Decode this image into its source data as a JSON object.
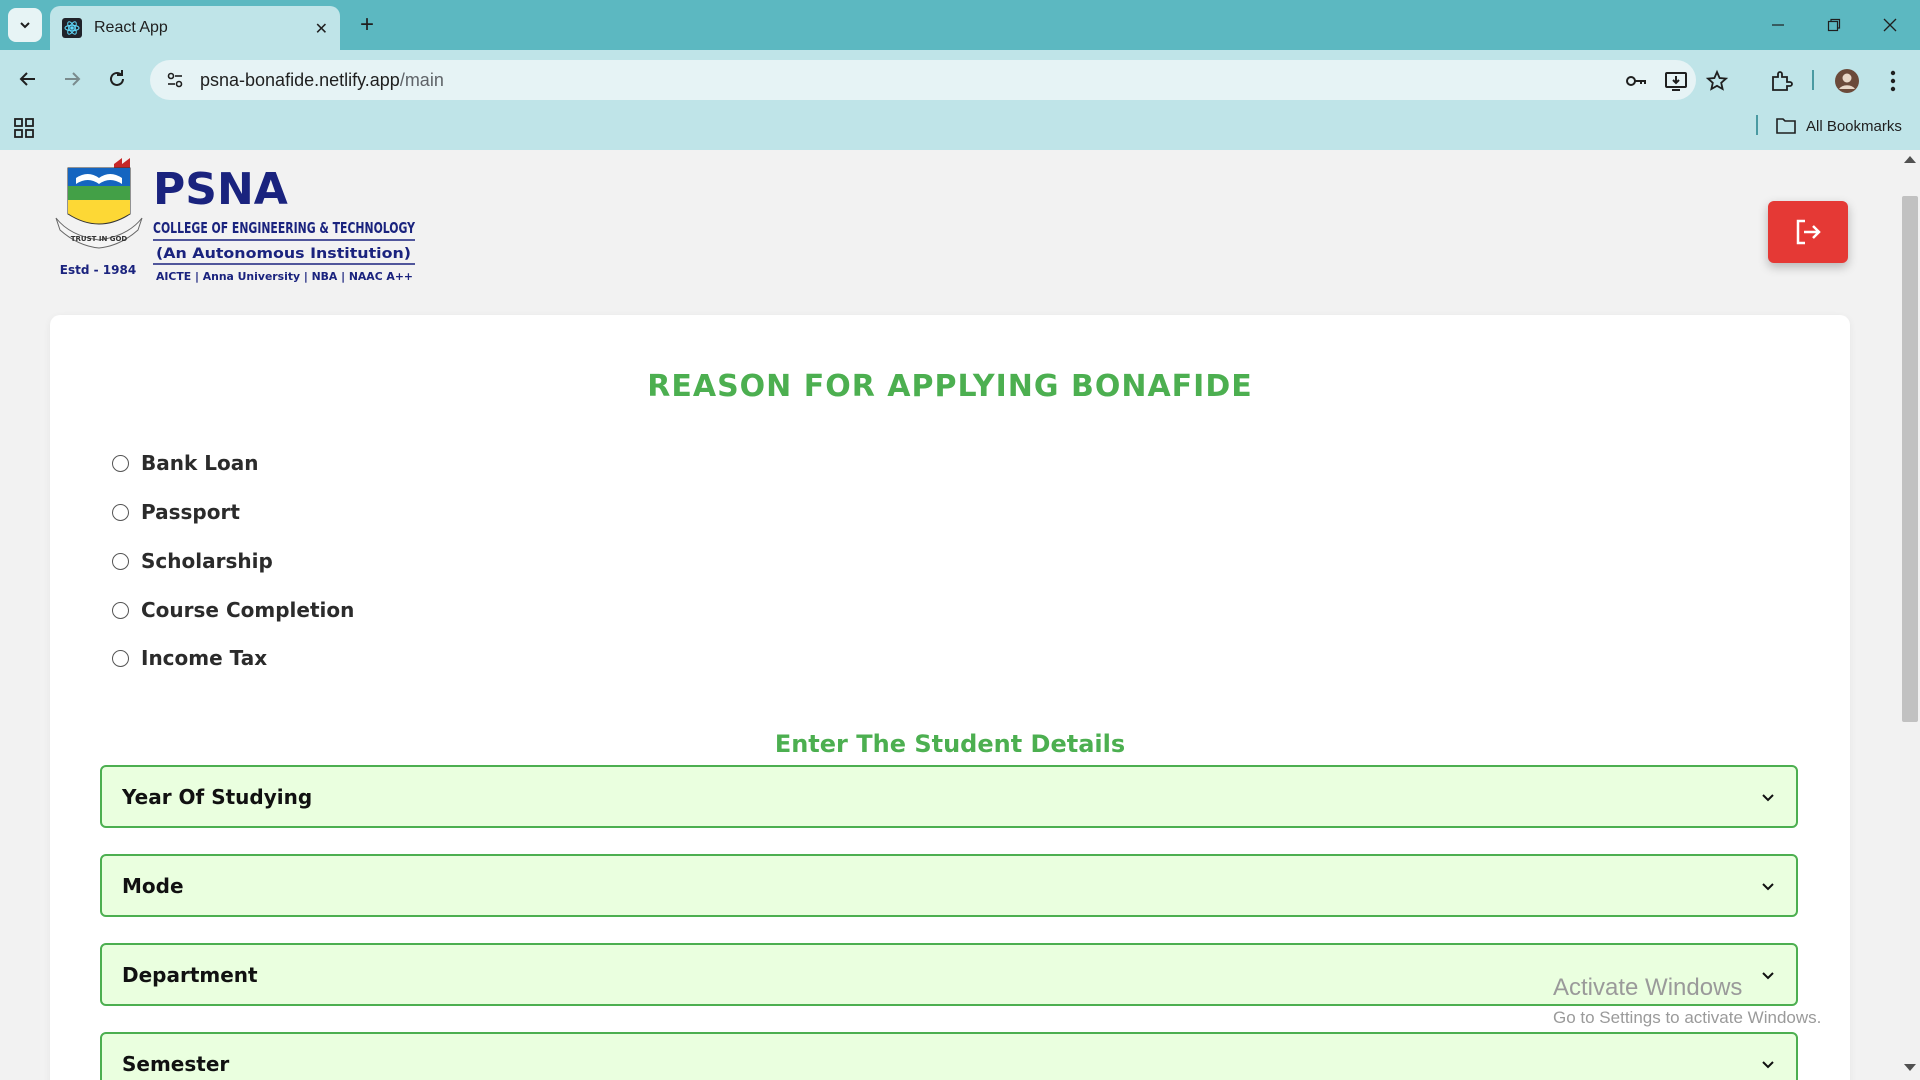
{
  "browser": {
    "tab_title": "React App",
    "url_host": "psna-bonafide.netlify.app",
    "url_path": "/main",
    "bookmarks_label": "All Bookmarks"
  },
  "header": {
    "logo": {
      "name": "PSNA",
      "college": "COLLEGE OF ENGINEERING & TECHNOLOGY",
      "autonomous": "(An Autonomous Institution)",
      "affiliations": "AICTE | Anna University | NBA | NAAC A++",
      "estd": "Estd - 1984",
      "motto": "TRUST IN GOD"
    },
    "logout_icon": "logout-icon",
    "logout_color": "#e53935"
  },
  "form": {
    "reason_title": "REASON FOR APPLYING BONAFIDE",
    "reasons": [
      {
        "label": "Bank Loan",
        "selected": false
      },
      {
        "label": "Passport",
        "selected": false
      },
      {
        "label": "Scholarship",
        "selected": false
      },
      {
        "label": "Course Completion",
        "selected": false
      },
      {
        "label": "Income Tax",
        "selected": false
      }
    ],
    "details_title": "Enter The Student Details",
    "selects": [
      {
        "label": "Year Of Studying"
      },
      {
        "label": "Mode"
      },
      {
        "label": "Department"
      },
      {
        "label": "Semester"
      }
    ],
    "accent_color": "#4caf50",
    "select_bg": "#eaffdf"
  },
  "watermark": {
    "line1": "Activate Windows",
    "line2": "Go to Settings to activate Windows."
  }
}
